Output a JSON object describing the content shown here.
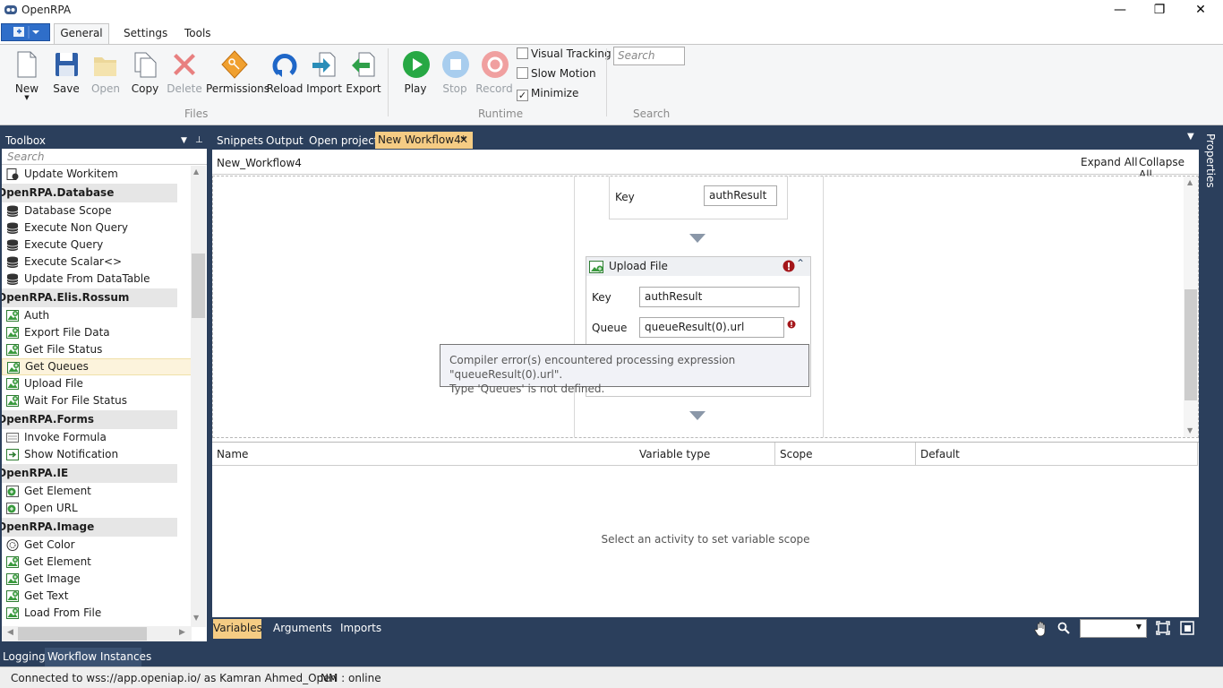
{
  "window": {
    "title": "OpenRPA",
    "min_symbol": "—",
    "max_symbol": "❐",
    "close_symbol": "✕"
  },
  "ribbon": {
    "tabs": [
      "General",
      "Settings",
      "Tools"
    ],
    "files_group": "Files",
    "runtime_group": "Runtime",
    "search_group": "Search",
    "buttons": {
      "new": "New",
      "save": "Save",
      "open": "Open",
      "copy": "Copy",
      "delete": "Delete",
      "permissions": "Permissions",
      "reload": "Reload",
      "import": "Import",
      "export": "Export",
      "play": "Play",
      "stop": "Stop",
      "record": "Record"
    },
    "checks": {
      "visual_tracking": "Visual Tracking",
      "visual_tracking_checked": false,
      "slow_motion": "Slow Motion",
      "slow_motion_checked": false,
      "minimize": "Minimize",
      "minimize_checked": true
    },
    "search_placeholder": "Search"
  },
  "toolbox": {
    "title": "Toolbox",
    "search_placeholder": "Search",
    "items": [
      {
        "kind": "item",
        "label": "Update Workitem",
        "icon": "workitem-icon"
      },
      {
        "kind": "cat",
        "label": "OpenRPA.Database"
      },
      {
        "kind": "item",
        "label": "Database Scope",
        "icon": "database-icon"
      },
      {
        "kind": "item",
        "label": "Execute Non Query",
        "icon": "database-icon"
      },
      {
        "kind": "item",
        "label": "Execute Query",
        "icon": "database-icon"
      },
      {
        "kind": "item",
        "label": "Execute Scalar<>",
        "icon": "database-icon"
      },
      {
        "kind": "item",
        "label": "Update From DataTable",
        "icon": "database-icon"
      },
      {
        "kind": "cat",
        "label": "OpenRPA.Elis.Rossum"
      },
      {
        "kind": "item",
        "label": "Auth",
        "icon": "image-add-icon"
      },
      {
        "kind": "item",
        "label": "Export File Data",
        "icon": "image-add-icon"
      },
      {
        "kind": "item",
        "label": "Get File Status",
        "icon": "image-add-icon"
      },
      {
        "kind": "item",
        "label": "Get Queues",
        "icon": "image-add-icon",
        "selected": true
      },
      {
        "kind": "item",
        "label": "Upload File",
        "icon": "image-add-icon"
      },
      {
        "kind": "item",
        "label": "Wait For File Status",
        "icon": "image-add-icon"
      },
      {
        "kind": "cat",
        "label": "OpenRPA.Forms"
      },
      {
        "kind": "item",
        "label": "Invoke Formula",
        "icon": "form-icon"
      },
      {
        "kind": "item",
        "label": "Show Notification",
        "icon": "notification-icon"
      },
      {
        "kind": "cat",
        "label": "OpenRPA.IE"
      },
      {
        "kind": "item",
        "label": "Get Element",
        "icon": "ie-element-icon"
      },
      {
        "kind": "item",
        "label": "Open URL",
        "icon": "ie-element-icon"
      },
      {
        "kind": "cat",
        "label": "OpenRPA.Image"
      },
      {
        "kind": "item",
        "label": "Get Color",
        "icon": "color-icon"
      },
      {
        "kind": "item",
        "label": "Get Element",
        "icon": "image-add-icon"
      },
      {
        "kind": "item",
        "label": "Get Image",
        "icon": "image-add-icon"
      },
      {
        "kind": "item",
        "label": "Get Text",
        "icon": "image-add-icon"
      },
      {
        "kind": "item",
        "label": "Load From File",
        "icon": "image-add-icon"
      }
    ]
  },
  "doc_tabs": {
    "snippets": "Snippets",
    "output": "Output",
    "open_project": "Open project",
    "active": "New Workflow4*"
  },
  "designer": {
    "breadcrumb": "New_Workflow4",
    "expand_all": "Expand All",
    "collapse_all": "Collapse All",
    "prev_activity": {
      "key_label": "Key",
      "key_value": "authResult"
    },
    "upload_file": {
      "title": "Upload File",
      "key_label": "Key",
      "key_value": "authResult",
      "queue_label": "Queue",
      "queue_value": "queueResult(0).url"
    },
    "tooltip": {
      "line1": "Compiler error(s) encountered processing expression \"queueResult(0).url\".",
      "line2": "Type 'Queues' is not defined."
    }
  },
  "variables": {
    "headers": [
      "Name",
      "Variable type",
      "Scope",
      "Default"
    ],
    "empty_message": "Select an activity to set variable scope"
  },
  "bottom_tabs": {
    "variables": "Variables",
    "arguments": "Arguments",
    "imports": "Imports"
  },
  "log_tabs": {
    "logging": "Logging",
    "workflow_instances": "Workflow Instances"
  },
  "properties_label": "Properties",
  "status": {
    "connection": "Connected to wss://app.openiap.io/ as Kamran Ahmed_Open",
    "nm": "NM : online"
  },
  "colors": {
    "chrome": "#2b3f5c",
    "active_tab": "#f5cc84",
    "error": "#a4161a",
    "play": "#27a844"
  }
}
